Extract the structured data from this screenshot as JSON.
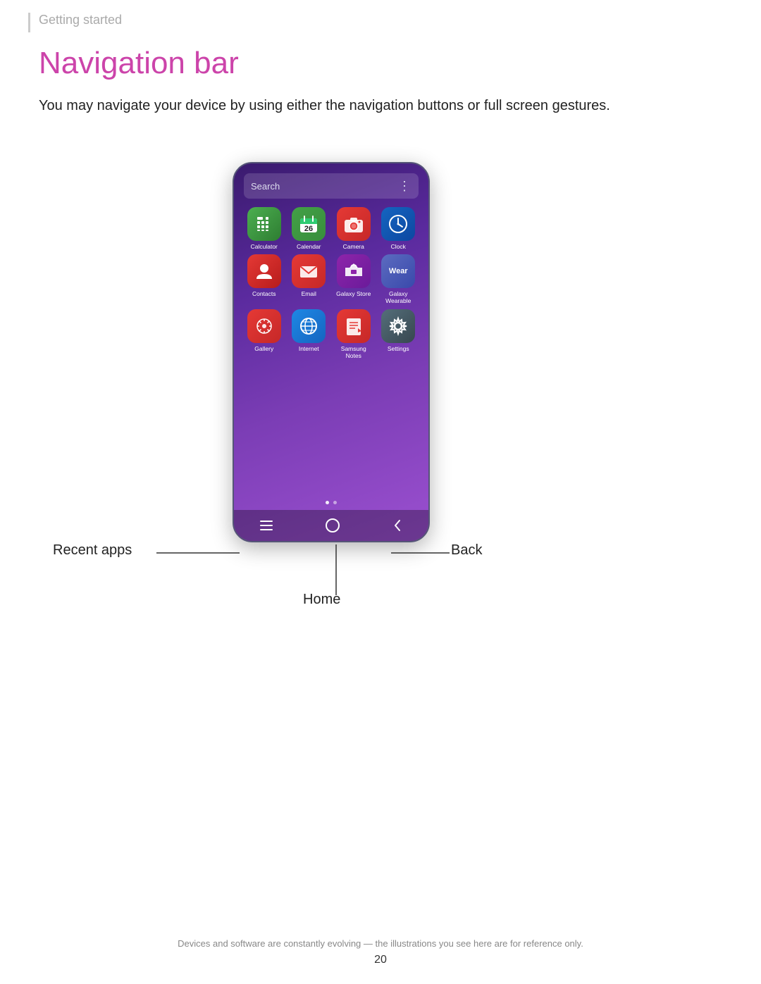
{
  "breadcrumb": "Getting started",
  "title": "Navigation bar",
  "description": "You may navigate your device by using either the navigation buttons or full screen gestures.",
  "phone": {
    "search_placeholder": "Search",
    "search_dots": "⋮",
    "apps": [
      {
        "id": "calculator",
        "label": "Calculator",
        "icon_class": "icon-calculator",
        "symbol": "±÷"
      },
      {
        "id": "calendar",
        "label": "Calendar",
        "icon_class": "icon-calendar",
        "symbol": "26"
      },
      {
        "id": "camera",
        "label": "Camera",
        "icon_class": "icon-camera",
        "symbol": "📷"
      },
      {
        "id": "clock",
        "label": "Clock",
        "icon_class": "icon-clock",
        "symbol": "◷"
      },
      {
        "id": "contacts",
        "label": "Contacts",
        "icon_class": "icon-contacts",
        "symbol": "👤"
      },
      {
        "id": "email",
        "label": "Email",
        "icon_class": "icon-email",
        "symbol": "✉"
      },
      {
        "id": "galaxy-store",
        "label": "Galaxy Store",
        "icon_class": "icon-galaxy-store",
        "symbol": "🛍"
      },
      {
        "id": "galaxy-wearable",
        "label": "Galaxy Wearable",
        "icon_class": "icon-galaxy-wearable",
        "symbol": "Wear"
      },
      {
        "id": "gallery",
        "label": "Gallery",
        "icon_class": "icon-gallery",
        "symbol": "✿"
      },
      {
        "id": "internet",
        "label": "Internet",
        "icon_class": "icon-internet",
        "symbol": "🌐"
      },
      {
        "id": "samsung-notes",
        "label": "Samsung\nNotes",
        "icon_class": "icon-samsung-notes",
        "symbol": "📋"
      },
      {
        "id": "settings",
        "label": "Settings",
        "icon_class": "icon-settings",
        "symbol": "⚙"
      }
    ],
    "nav": {
      "recent": "|||",
      "home": "○",
      "back": "‹"
    }
  },
  "labels": {
    "recent_apps": "Recent apps",
    "home": "Home",
    "back": "Back"
  },
  "footer": {
    "note": "Devices and software are constantly evolving — the illustrations you see here are for reference only.",
    "page": "20"
  }
}
